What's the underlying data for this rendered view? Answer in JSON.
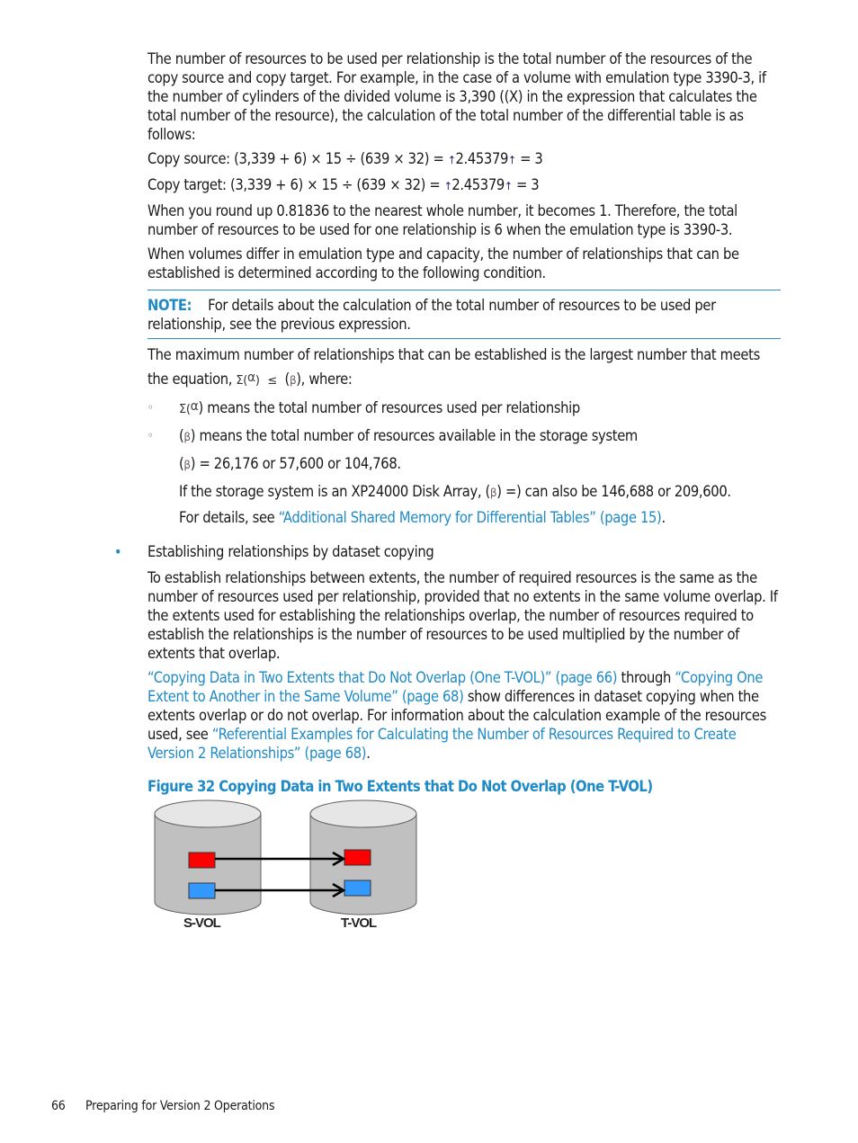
{
  "page": {
    "intro_paragraph": "The number of resources to be used per relationship is the total number of the resources of the copy source and copy target. For example, in the case of a volume with emulation type 3390-3, if the number of cylinders of the divided volume is 3,390 ((X) in the expression that calculates the total number of the resource), the calculation of the total number of the differential table is as follows:",
    "copy_source": {
      "prefix": "Copy source: (3,339 + 6) × 15 ",
      "divide": "÷",
      "middle": " (639 × 32) = ",
      "value": "2.45379",
      "suffix": " = 3"
    },
    "copy_target": {
      "prefix": "Copy target: (3,339 + 6) × 15 ",
      "divide": "÷",
      "middle": " (639 × 32) = ",
      "value": "2.45379",
      "suffix": " = 3"
    },
    "round_up_paragraph": "When you round up 0.81836 to the nearest whole number, it becomes 1. Therefore, the total number of resources to be used for one relationship is 6 when the emulation type is 3390-3.",
    "differ_paragraph": "When volumes differ in emulation type and capacity, the number of relationships that can be established is determined according to the following condition.",
    "note": {
      "label": "NOTE:",
      "text": "For details about the calculation of the total number of resources to be used per relationship, see the previous expression."
    },
    "max_paragraph": {
      "text_before": "The maximum number of relationships that can be established is the largest number that meets the equation, ",
      "sigma": "Σ(",
      "alpha": "α",
      "close": ")",
      "leq": "≤",
      "beta_open": "(",
      "beta": "β",
      "text_after": "), where:"
    },
    "sub_items": [
      {
        "bullet": "◦",
        "sigma": "Σ(",
        "alpha": "α",
        "text": ") means the total number of resources used per relationship"
      },
      {
        "bullet": "◦",
        "beta_open": "(",
        "beta": "β",
        "text": ") means the total number of resources available in the storage system"
      }
    ],
    "beta_values": {
      "open": "(",
      "beta": "β",
      "text": ") = 26,176 or 57,600 or 104,768."
    },
    "xp_line": {
      "before": "If the storage system is an XP24000 Disk Array, (",
      "beta": "β",
      "after": ") =) can also be 146,688 or 209,600."
    },
    "details_line": {
      "before": "For details, see ",
      "link": "“Additional Shared Memory for Differential Tables” (page 15)",
      "after": "."
    },
    "bullet_item": {
      "title": "Establishing relationships by dataset copying",
      "paragraph": "To establish relationships between extents, the number of required resources is the same as the number of resources used per relationship, provided that no extents in the same volume overlap. If the extents used for establishing the relationships overlap, the number of resources required to establish the relationships is the number of resources to be used multiplied by the number of extents that overlap.",
      "refs": {
        "link1": "“Copying Data in Two Extents that Do Not Overlap (One T-VOL)” (page 66)",
        "through": " through ",
        "link2": "“Copying One Extent to Another in the Same Volume” (page 68)",
        "middle": " show differences in dataset copying when the extents overlap or do not overlap. For information about the calculation example of the resources used, see ",
        "link3": "“Referential Examples for Calculating the Number of Resources Required to Create Version 2 Relationships” (page 68)",
        "end": "."
      }
    },
    "figure": {
      "title": "Figure 32 Copying Data in Two Extents that Do Not Overlap (One T-VOL)",
      "svol_label": "S-VOL",
      "tvol_label": "T-VOL",
      "colors": {
        "red_extent": "#ff0000",
        "blue_extent": "#3399ff",
        "cylinder": "#c0c0c0",
        "cylinder_top": "#e8e8e8"
      }
    },
    "footer": {
      "page_number": "66",
      "section": "Preparing for Version 2 Operations"
    }
  }
}
